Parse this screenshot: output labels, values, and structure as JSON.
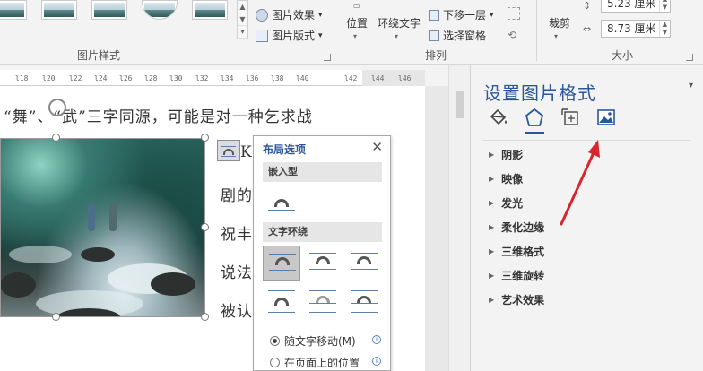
{
  "ribbon": {
    "picture_styles_label": "图片样式",
    "effects_label": "图片效果",
    "effects_arrow": "▾",
    "layout_label": "图片版式",
    "layout_arrow": "▾",
    "position_label": "位置",
    "wrap_text_label": "环绕文字",
    "send_back_label": "下移一层",
    "send_back_arrow": "▾",
    "selection_pane_label": "选择窗格",
    "arrange_label": "排列",
    "crop_label": "裁剪",
    "size_label": "大小",
    "height_value": "5.23 厘米",
    "width_value": "8.73 厘米"
  },
  "ruler": {
    "ticks": [
      "l18",
      "l20",
      "l22",
      "l24",
      "l26",
      "l28",
      "l30",
      "l32",
      "l34",
      "l36",
      "l38",
      "l40",
      "l42",
      "l44",
      "l46"
    ]
  },
  "document": {
    "line1": "“舞”、“武”三字同源，可能是对一种乞求战",
    "line2_start": "K",
    "line3": "剧的",
    "line4": "祝丰",
    "line5": "说法",
    "line6": "被认"
  },
  "layout_panel": {
    "title": "布局选项",
    "close": "✕",
    "inline_section": "嵌入型",
    "wrap_section": "文字环绕",
    "move_with_text": "随文字移动(M)",
    "fix_position": "在页面上的位置",
    "info_glyph": "i"
  },
  "pane": {
    "title": "设置图片格式",
    "menu_glyph": "▾",
    "sections": [
      "阴影",
      "映像",
      "发光",
      "柔化边缘",
      "三维格式",
      "三维旋转",
      "艺术效果"
    ],
    "tri_glyph": "▶"
  },
  "colors": {
    "accent": "#2b579a",
    "arrow": "#d9262c"
  }
}
